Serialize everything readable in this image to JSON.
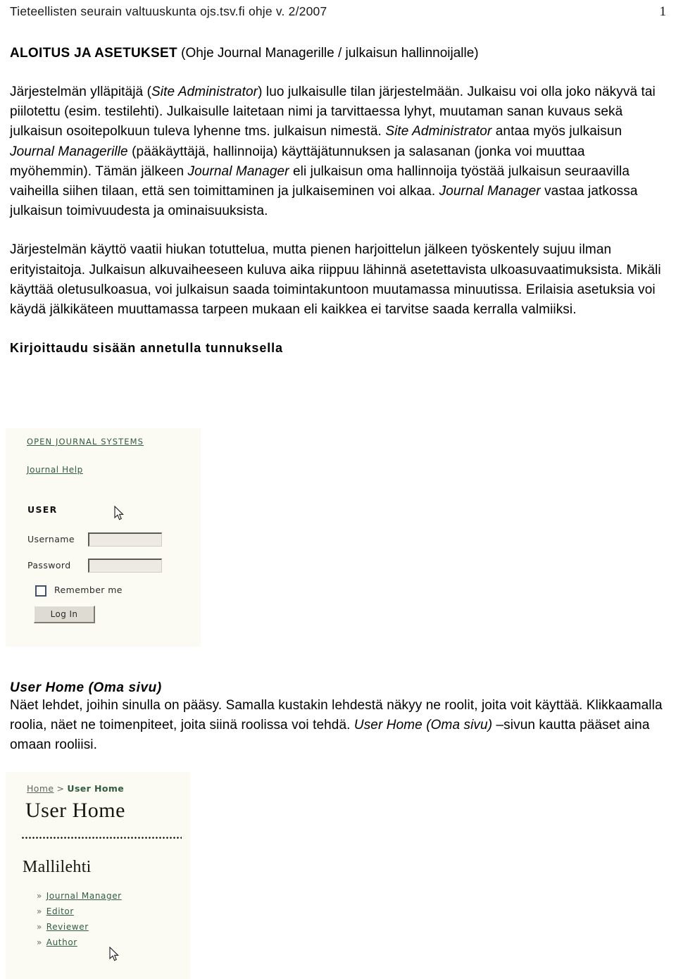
{
  "header": {
    "running_text": "Tieteellisten seurain valtuuskunta ojs.tsv.fi ohje v. 2/2007",
    "page_number": "1"
  },
  "document": {
    "title_strong": "ALOITUS JA ASETUKSET",
    "title_rest": " (Ohje Journal Managerille / julkaisun hallinnoijalle)",
    "paragraph_1": {
      "s1": "Järjestelmän ylläpitäjä (",
      "i1": "Site Administrator",
      "s2": ") luo julkaisulle tilan järjestelmään. Julkaisu voi olla joko näkyvä tai piilotettu (esim. testilehti). Julkaisulle laitetaan nimi ja tarvittaessa lyhyt, muutaman sanan kuvaus sekä julkaisun osoitepolkuun tuleva lyhenne tms. julkaisun nimestä. ",
      "i2": "Site Administrator",
      "s3": " antaa myös julkaisun ",
      "i3": "Journal Managerille",
      "s4": " (pääkäyttäjä, hallinnoija) käyttäjätunnuksen ja salasanan (jonka voi muuttaa myöhemmin). Tämän jälkeen ",
      "i4": "Journal Manager",
      "s5": " eli julkaisun oma hallinnoija työstää julkaisun seuraavilla vaiheilla siihen tilaan, että sen toimittaminen ja julkaiseminen voi alkaa. ",
      "i5": "Journal Manager",
      "s6": " vastaa jatkossa julkaisun toimivuudesta ja ominaisuuksista."
    },
    "paragraph_2": "Järjestelmän käyttö vaatii hiukan totuttelua, mutta pienen harjoittelun jälkeen työskentely sujuu ilman erityistaitoja. Julkaisun alkuvaiheeseen kuluva aika riippuu lähinnä asetettavista ulkoasuvaatimuksista. Mikäli käyttää oletusulkoasua, voi julkaisun saada toimintakuntoon muutamassa minuutissa. Erilaisia asetuksia voi käydä jälkikäteen muuttamassa tarpeen mukaan eli kaikkea ei tarvitse saada kerralla valmiiksi.",
    "subheading_login": "Kirjoittaudu sisään annetulla tunnuksella",
    "section_userhome": {
      "heading": "User Home (Oma sivu)",
      "body_s1": "Näet lehdet, joihin sinulla on pääsy. Samalla kustakin lehdestä näkyy ne roolit, joita voit käyttää. Klikkaamalla roolia, näet ne toimenpiteet, joita siinä roolissa voi tehdä. ",
      "body_i1": "User Home (Oma sivu)",
      "body_s2": " –sivun kautta pääset aina omaan rooliisi."
    }
  },
  "login_screenshot": {
    "site_link": "OPEN JOURNAL SYSTEMS",
    "help_link": "Journal Help",
    "user_block_title": "USER",
    "username_label": "Username",
    "username_value": "",
    "password_label": "Password",
    "password_value": "",
    "remember_label": "Remember me",
    "login_button": "Log In",
    "link_color": "#2f5d3f",
    "background_color": "#fbfaf3"
  },
  "userhome_screenshot": {
    "breadcrumb_home": "Home",
    "breadcrumb_sep": ">",
    "breadcrumb_current": "User Home",
    "page_title": "User Home",
    "journal_name": "Mallilehti",
    "roles": [
      {
        "bullet": "»",
        "label": "Journal Manager"
      },
      {
        "bullet": "»",
        "label": "Editor"
      },
      {
        "bullet": "»",
        "label": "Reviewer"
      },
      {
        "bullet": "»",
        "label": "Author"
      }
    ],
    "link_color": "#2f5d3f",
    "background_color": "#fbfaf3"
  }
}
